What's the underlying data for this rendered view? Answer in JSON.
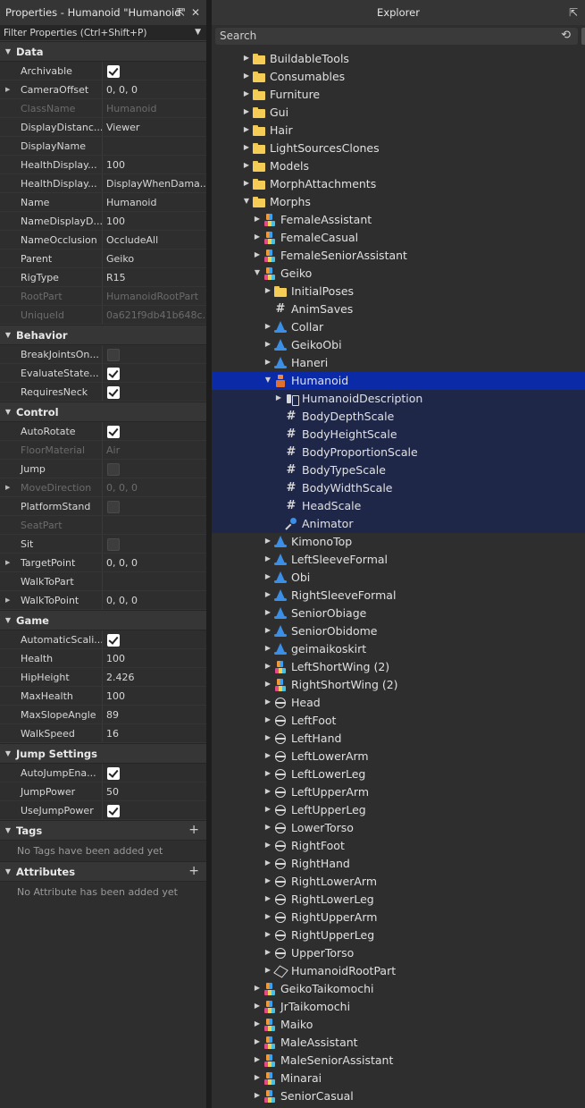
{
  "properties": {
    "title": "Properties - Humanoid \"Humanoid\"",
    "filter_placeholder": "Filter Properties (Ctrl+Shift+P)",
    "categories": [
      {
        "name": "Data",
        "rows": [
          {
            "name": "Archivable",
            "type": "check",
            "value": true
          },
          {
            "name": "CameraOffset",
            "value": "0, 0, 0",
            "expandable": true
          },
          {
            "name": "ClassName",
            "value": "Humanoid",
            "disabled": true
          },
          {
            "name": "DisplayDistanc...",
            "value": "Viewer"
          },
          {
            "name": "DisplayName",
            "value": ""
          },
          {
            "name": "HealthDisplay...",
            "value": "100"
          },
          {
            "name": "HealthDisplay...",
            "value": "DisplayWhenDama..."
          },
          {
            "name": "Name",
            "value": "Humanoid"
          },
          {
            "name": "NameDisplayD...",
            "value": "100"
          },
          {
            "name": "NameOcclusion",
            "value": "OccludeAll"
          },
          {
            "name": "Parent",
            "value": "Geiko"
          },
          {
            "name": "RigType",
            "value": "R15"
          },
          {
            "name": "RootPart",
            "value": "HumanoidRootPart",
            "disabled": true
          },
          {
            "name": "UniqueId",
            "value": "0a621f9db41b648c...",
            "disabled": true
          }
        ]
      },
      {
        "name": "Behavior",
        "rows": [
          {
            "name": "BreakJointsOn...",
            "type": "check",
            "value": false
          },
          {
            "name": "EvaluateState...",
            "type": "check",
            "value": true
          },
          {
            "name": "RequiresNeck",
            "type": "check",
            "value": true
          }
        ]
      },
      {
        "name": "Control",
        "rows": [
          {
            "name": "AutoRotate",
            "type": "check",
            "value": true
          },
          {
            "name": "FloorMaterial",
            "value": "Air",
            "disabled": true
          },
          {
            "name": "Jump",
            "type": "check",
            "value": false
          },
          {
            "name": "MoveDirection",
            "value": "0, 0, 0",
            "disabled": true,
            "expandable": true
          },
          {
            "name": "PlatformStand",
            "type": "check",
            "value": false
          },
          {
            "name": "SeatPart",
            "value": "",
            "disabled": true
          },
          {
            "name": "Sit",
            "type": "check",
            "value": false
          },
          {
            "name": "TargetPoint",
            "value": "0, 0, 0",
            "expandable": true
          },
          {
            "name": "WalkToPart",
            "value": ""
          },
          {
            "name": "WalkToPoint",
            "value": "0, 0, 0",
            "expandable": true
          }
        ]
      },
      {
        "name": "Game",
        "rows": [
          {
            "name": "AutomaticScali...",
            "type": "check",
            "value": true
          },
          {
            "name": "Health",
            "value": "100"
          },
          {
            "name": "HipHeight",
            "value": "2.426"
          },
          {
            "name": "MaxHealth",
            "value": "100"
          },
          {
            "name": "MaxSlopeAngle",
            "value": "89"
          },
          {
            "name": "WalkSpeed",
            "value": "16"
          }
        ]
      },
      {
        "name": "Jump Settings",
        "rows": [
          {
            "name": "AutoJumpEna...",
            "type": "check",
            "value": true
          },
          {
            "name": "JumpPower",
            "value": "50"
          },
          {
            "name": "UseJumpPower",
            "type": "check",
            "value": true
          }
        ]
      },
      {
        "name": "Tags",
        "plus": true,
        "empty": "No Tags have been added yet"
      },
      {
        "name": "Attributes",
        "plus": true,
        "empty": "No Attribute has been added yet"
      }
    ]
  },
  "explorer": {
    "title": "Explorer",
    "search_placeholder": "Search",
    "nodes": [
      {
        "name": "BuildableTools",
        "icon": "folder",
        "depth": 0,
        "arrow": "right"
      },
      {
        "name": "Consumables",
        "icon": "folder",
        "depth": 0,
        "arrow": "right"
      },
      {
        "name": "Furniture",
        "icon": "folder",
        "depth": 0,
        "arrow": "right"
      },
      {
        "name": "Gui",
        "icon": "folder",
        "depth": 0,
        "arrow": "right"
      },
      {
        "name": "Hair",
        "icon": "folder",
        "depth": 0,
        "arrow": "right"
      },
      {
        "name": "LightSourcesClones",
        "icon": "folder",
        "depth": 0,
        "arrow": "right"
      },
      {
        "name": "Models",
        "icon": "folder",
        "depth": 0,
        "arrow": "right"
      },
      {
        "name": "MorphAttachments",
        "icon": "folder",
        "depth": 0,
        "arrow": "right"
      },
      {
        "name": "Morphs",
        "icon": "folder",
        "depth": 0,
        "arrow": "down"
      },
      {
        "name": "FemaleAssistant",
        "icon": "model",
        "depth": 1,
        "arrow": "right"
      },
      {
        "name": "FemaleCasual",
        "icon": "model",
        "depth": 1,
        "arrow": "right"
      },
      {
        "name": "FemaleSeniorAssistant",
        "icon": "model",
        "depth": 1,
        "arrow": "right"
      },
      {
        "name": "Geiko",
        "icon": "model",
        "depth": 1,
        "arrow": "down"
      },
      {
        "name": "InitialPoses",
        "icon": "folder",
        "depth": 2,
        "arrow": "right"
      },
      {
        "name": "AnimSaves",
        "icon": "hash",
        "depth": 2,
        "arrow": ""
      },
      {
        "name": "Collar",
        "icon": "hat",
        "depth": 2,
        "arrow": "right"
      },
      {
        "name": "GeikoObi",
        "icon": "hat",
        "depth": 2,
        "arrow": "right"
      },
      {
        "name": "Haneri",
        "icon": "hat",
        "depth": 2,
        "arrow": "right"
      },
      {
        "name": "Humanoid",
        "icon": "human",
        "depth": 2,
        "arrow": "down",
        "selected": true
      },
      {
        "name": "HumanoidDescription",
        "icon": "hdesc",
        "depth": 3,
        "arrow": "right",
        "desc": true
      },
      {
        "name": "BodyDepthScale",
        "icon": "hash",
        "depth": 3,
        "arrow": "",
        "desc": true
      },
      {
        "name": "BodyHeightScale",
        "icon": "hash",
        "depth": 3,
        "arrow": "",
        "desc": true
      },
      {
        "name": "BodyProportionScale",
        "icon": "hash",
        "depth": 3,
        "arrow": "",
        "desc": true
      },
      {
        "name": "BodyTypeScale",
        "icon": "hash",
        "depth": 3,
        "arrow": "",
        "desc": true
      },
      {
        "name": "BodyWidthScale",
        "icon": "hash",
        "depth": 3,
        "arrow": "",
        "desc": true
      },
      {
        "name": "HeadScale",
        "icon": "hash",
        "depth": 3,
        "arrow": "",
        "desc": true
      },
      {
        "name": "Animator",
        "icon": "anim",
        "depth": 3,
        "arrow": "",
        "desc": true
      },
      {
        "name": "KimonoTop",
        "icon": "hat",
        "depth": 2,
        "arrow": "right"
      },
      {
        "name": "LeftSleeveFormal",
        "icon": "hat",
        "depth": 2,
        "arrow": "right"
      },
      {
        "name": "Obi",
        "icon": "hat",
        "depth": 2,
        "arrow": "right"
      },
      {
        "name": "RightSleeveFormal",
        "icon": "hat",
        "depth": 2,
        "arrow": "right"
      },
      {
        "name": "SeniorObiage",
        "icon": "hat",
        "depth": 2,
        "arrow": "right"
      },
      {
        "name": "SeniorObidome",
        "icon": "hat",
        "depth": 2,
        "arrow": "right"
      },
      {
        "name": "geimaikoskirt",
        "icon": "hat",
        "depth": 2,
        "arrow": "right"
      },
      {
        "name": "LeftShortWing (2)",
        "icon": "model",
        "depth": 2,
        "arrow": "right"
      },
      {
        "name": "RightShortWing (2)",
        "icon": "model",
        "depth": 2,
        "arrow": "right"
      },
      {
        "name": "Head",
        "icon": "mesh",
        "depth": 2,
        "arrow": "right"
      },
      {
        "name": "LeftFoot",
        "icon": "mesh",
        "depth": 2,
        "arrow": "right"
      },
      {
        "name": "LeftHand",
        "icon": "mesh",
        "depth": 2,
        "arrow": "right"
      },
      {
        "name": "LeftLowerArm",
        "icon": "mesh",
        "depth": 2,
        "arrow": "right"
      },
      {
        "name": "LeftLowerLeg",
        "icon": "mesh",
        "depth": 2,
        "arrow": "right"
      },
      {
        "name": "LeftUpperArm",
        "icon": "mesh",
        "depth": 2,
        "arrow": "right"
      },
      {
        "name": "LeftUpperLeg",
        "icon": "mesh",
        "depth": 2,
        "arrow": "right"
      },
      {
        "name": "LowerTorso",
        "icon": "mesh",
        "depth": 2,
        "arrow": "right"
      },
      {
        "name": "RightFoot",
        "icon": "mesh",
        "depth": 2,
        "arrow": "right"
      },
      {
        "name": "RightHand",
        "icon": "mesh",
        "depth": 2,
        "arrow": "right"
      },
      {
        "name": "RightLowerArm",
        "icon": "mesh",
        "depth": 2,
        "arrow": "right"
      },
      {
        "name": "RightLowerLeg",
        "icon": "mesh",
        "depth": 2,
        "arrow": "right"
      },
      {
        "name": "RightUpperArm",
        "icon": "mesh",
        "depth": 2,
        "arrow": "right"
      },
      {
        "name": "RightUpperLeg",
        "icon": "mesh",
        "depth": 2,
        "arrow": "right"
      },
      {
        "name": "UpperTorso",
        "icon": "mesh",
        "depth": 2,
        "arrow": "right"
      },
      {
        "name": "HumanoidRootPart",
        "icon": "part",
        "depth": 2,
        "arrow": "right"
      },
      {
        "name": "GeikoTaikomochi",
        "icon": "model",
        "depth": 1,
        "arrow": "right"
      },
      {
        "name": "JrTaikomochi",
        "icon": "model",
        "depth": 1,
        "arrow": "right"
      },
      {
        "name": "Maiko",
        "icon": "model",
        "depth": 1,
        "arrow": "right"
      },
      {
        "name": "MaleAssistant",
        "icon": "model",
        "depth": 1,
        "arrow": "right"
      },
      {
        "name": "MaleSeniorAssistant",
        "icon": "model",
        "depth": 1,
        "arrow": "right"
      },
      {
        "name": "Minarai",
        "icon": "model",
        "depth": 1,
        "arrow": "right"
      },
      {
        "name": "SeniorCasual",
        "icon": "model",
        "depth": 1,
        "arrow": "right"
      }
    ]
  },
  "colors": {
    "selection": "#0b2aa8",
    "descendant_highlight": "#1f2748",
    "folder": "#f5cd56",
    "accent_blue": "#3b8fe6"
  }
}
